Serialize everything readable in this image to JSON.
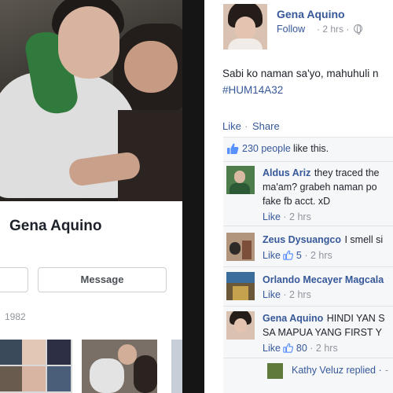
{
  "profile": {
    "name": "Gena Aquino",
    "message_button": "Message",
    "birth_year": "1982"
  },
  "post": {
    "author": "Gena Aquino",
    "follow": "Follow",
    "time": "· 2 hrs ·",
    "text": "Sabi ko naman sa'yo, mahuhuli n",
    "hashtag": "#HUM14A32",
    "actions": {
      "like": "Like",
      "separator": "·",
      "share": "Share"
    },
    "likes": {
      "count": "230 people",
      "suffix": "like this."
    }
  },
  "comments": [
    {
      "name": "Aldus Ariz",
      "text1": "they traced the",
      "text2": "ma'am? grabeh naman po",
      "text3": "fake fb acct. xD",
      "like": "Like",
      "time": "· 2 hrs",
      "count": ""
    },
    {
      "name": "Zeus Dysuangco",
      "text1": "I smell si",
      "like": "Like",
      "count": "5",
      "time": "· 2 hrs"
    },
    {
      "name": "Orlando Mecayer Magcala",
      "text1": "",
      "like": "Like",
      "time": "· 2 hrs",
      "count": ""
    },
    {
      "name": "Gena Aquino",
      "text1": "HINDI YAN S",
      "text2": "SA MAPUA YANG FIRST Y",
      "like": "Like",
      "count": "80",
      "time": "· 2 hrs"
    }
  ],
  "reply": {
    "text": "Kathy Veluz replied ·",
    "dash": "-"
  },
  "colors": {
    "link": "#365899",
    "text": "#1d2129",
    "muted": "#90949c",
    "feedback_bg": "#f6f7f9"
  },
  "icons": [
    "thumbs-up-icon",
    "globe-icon"
  ]
}
